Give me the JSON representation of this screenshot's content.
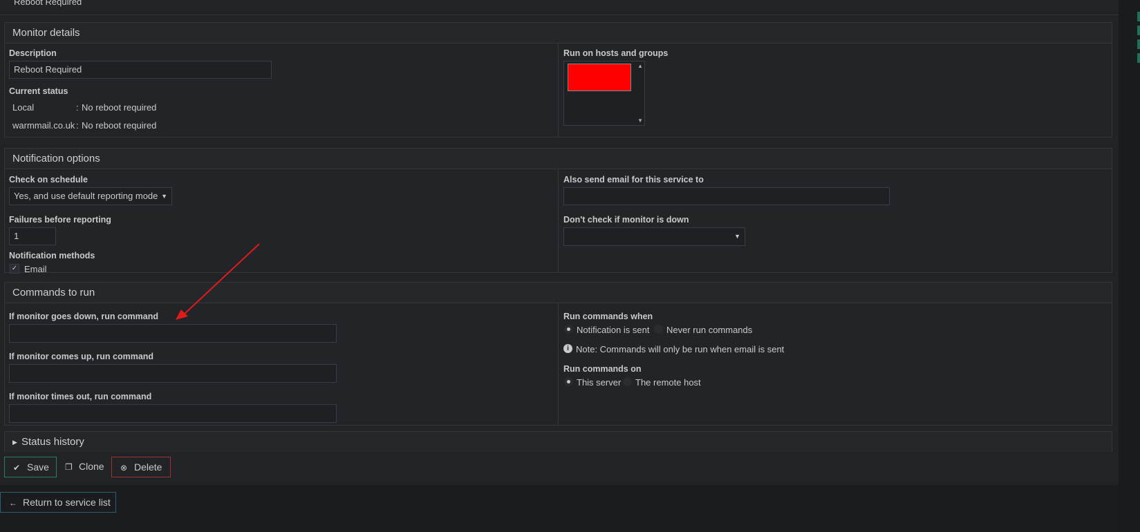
{
  "header": {
    "title": "Reboot Required"
  },
  "monitor_details": {
    "heading": "Monitor details",
    "description_label": "Description",
    "description_value": "Reboot Required",
    "current_status_label": "Current status",
    "status_rows": [
      {
        "host": "Local",
        "sep": ":",
        "status": "No reboot required"
      },
      {
        "host": "warmmail.co.uk",
        "sep": ":",
        "status": "No reboot required"
      }
    ],
    "run_on_label": "Run on hosts and groups"
  },
  "notification_options": {
    "heading": "Notification options",
    "check_schedule_label": "Check on schedule",
    "check_schedule_value": "Yes, and use default reporting mode",
    "failures_label": "Failures before reporting",
    "failures_value": "1",
    "methods_label": "Notification methods",
    "method_email": "Email",
    "also_email_label": "Also send email for this service to",
    "also_email_value": "",
    "dont_check_label": "Don't check if monitor is down",
    "dont_check_value": ""
  },
  "commands": {
    "heading": "Commands to run",
    "down_label": "If monitor goes down, run command",
    "up_label": "If monitor comes up, run command",
    "timeout_label": "If monitor times out, run command",
    "run_when_label": "Run commands when",
    "run_when_options": [
      "Notification is sent",
      "Never run commands"
    ],
    "note": "Note: Commands will only be run when email is sent",
    "run_on_label": "Run commands on",
    "run_on_options": [
      "This server",
      "The remote host"
    ]
  },
  "status_history": {
    "heading": "Status history"
  },
  "actions": {
    "save": "Save",
    "clone": "Clone",
    "delete": "Delete"
  },
  "footer": {
    "return": "Return to service list"
  },
  "colors": {
    "save_border": "#2e7d5b",
    "delete_border": "#a33232",
    "return_border": "#2d5f7a",
    "arrow": "#e01b1b",
    "redact": "#ff0000"
  }
}
